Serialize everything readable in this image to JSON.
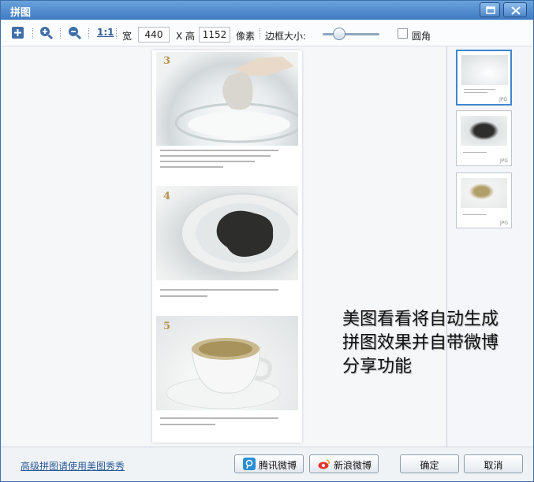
{
  "window": {
    "title": "拼图"
  },
  "toolbar": {
    "zoom_ratio_label": "1:1",
    "width_label": "宽",
    "width_value": "440",
    "times_label": "X 高",
    "height_value": "1152",
    "unit_label": "像素",
    "border_label": "边框大小:",
    "border_size": 0.3,
    "rounded_label": "圆角",
    "rounded_checked": false
  },
  "collage": {
    "steps": [
      "3",
      "4",
      "5"
    ]
  },
  "thumbnails": [
    {
      "format": "JPG",
      "selected": true
    },
    {
      "format": "JPG",
      "selected": false
    },
    {
      "format": "JPG",
      "selected": false
    }
  ],
  "overlay": {
    "text": "美图看看将自动生成\n拼图效果并自带微博\n分享功能"
  },
  "footer": {
    "advanced_link": "高级拼图请使用美图秀秀",
    "tencent_weibo": "腾讯微博",
    "sina_weibo": "新浪微博",
    "ok": "确定",
    "cancel": "取消"
  },
  "colors": {
    "titlebar": "#3f7bc3",
    "selection": "#3e86cf",
    "link": "#2a5a9a"
  }
}
